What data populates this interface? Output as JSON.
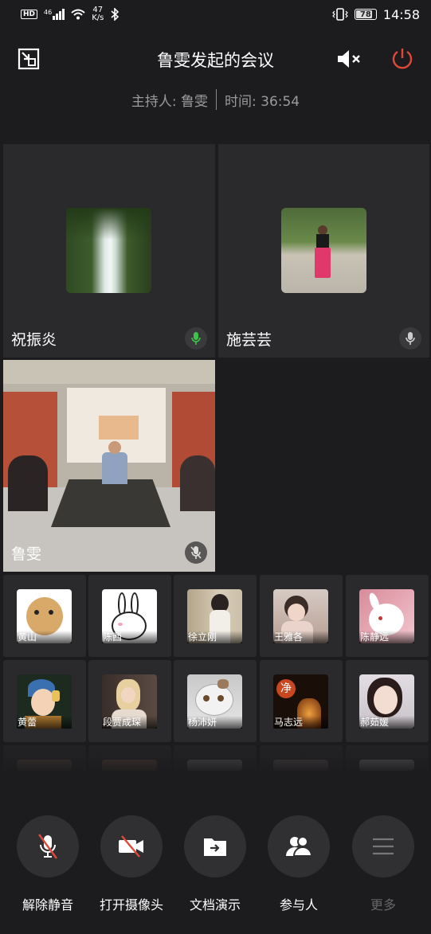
{
  "status_bar": {
    "hd": "HD",
    "signal": "46",
    "speed_value": "47",
    "speed_unit": "K/s",
    "battery": "78",
    "time": "14:58"
  },
  "header": {
    "title": "鲁雯发起的会议",
    "host_label": "主持人: 鲁雯",
    "time_label": "时间: 36:54"
  },
  "main_tiles": [
    {
      "name": "祝振炎",
      "mic": "active"
    },
    {
      "name": "施芸芸",
      "mic": "idle"
    },
    {
      "name": "鲁雯",
      "mic": "muted"
    }
  ],
  "participants_row1": [
    "黄山",
    "陈西",
    "徐立刚",
    "王雅各",
    "陈静远"
  ],
  "participants_row2": [
    "黄蕾",
    "段贾成琛",
    "杨沛妍",
    "马志远",
    "郝茹媛"
  ],
  "thumb_overlay_text": "净",
  "controls": [
    {
      "label": "解除静音",
      "icon": "microphone-muted-icon"
    },
    {
      "label": "打开摄像头",
      "icon": "camera-off-icon"
    },
    {
      "label": "文档演示",
      "icon": "document-share-icon"
    },
    {
      "label": "参与人",
      "icon": "participants-icon"
    },
    {
      "label": "更多",
      "icon": "menu-icon"
    }
  ],
  "colors": {
    "background": "#1c1c1e",
    "tile": "#2a2a2c",
    "power": "#e0483a",
    "mic_active": "#3ec24a"
  }
}
